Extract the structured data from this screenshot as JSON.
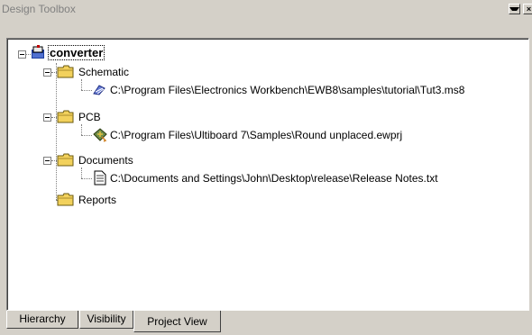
{
  "window": {
    "title": "Design Toolbox",
    "minimize_glyph": "▾",
    "close_glyph": "×"
  },
  "tree": {
    "root": {
      "label": "converter",
      "icon": "project-icon"
    },
    "folders": [
      {
        "label": "Schematic",
        "icon": "folder-icon",
        "files": [
          {
            "label": "C:\\Program Files\\Electronics Workbench\\EWB8\\samples\\tutorial\\Tut3.ms8",
            "icon": "schematic-file-icon"
          }
        ]
      },
      {
        "label": "PCB",
        "icon": "folder-icon",
        "files": [
          {
            "label": "C:\\Program Files\\Ultiboard 7\\Samples\\Round unplaced.ewprj",
            "icon": "pcb-file-icon"
          }
        ]
      },
      {
        "label": "Documents",
        "icon": "folder-icon",
        "files": [
          {
            "label": "C:\\Documents and Settings\\John\\Desktop\\release\\Release Notes.txt",
            "icon": "text-file-icon"
          }
        ]
      },
      {
        "label": "Reports",
        "icon": "folder-icon",
        "files": []
      }
    ]
  },
  "tabs": [
    {
      "label": "Hierarchy",
      "active": false
    },
    {
      "label": "Visibility",
      "active": false
    },
    {
      "label": "Project View",
      "active": true
    }
  ],
  "colors": {
    "chrome": "#d4d0c8",
    "folder": "#f2d15c",
    "panel": "#ffffff"
  }
}
